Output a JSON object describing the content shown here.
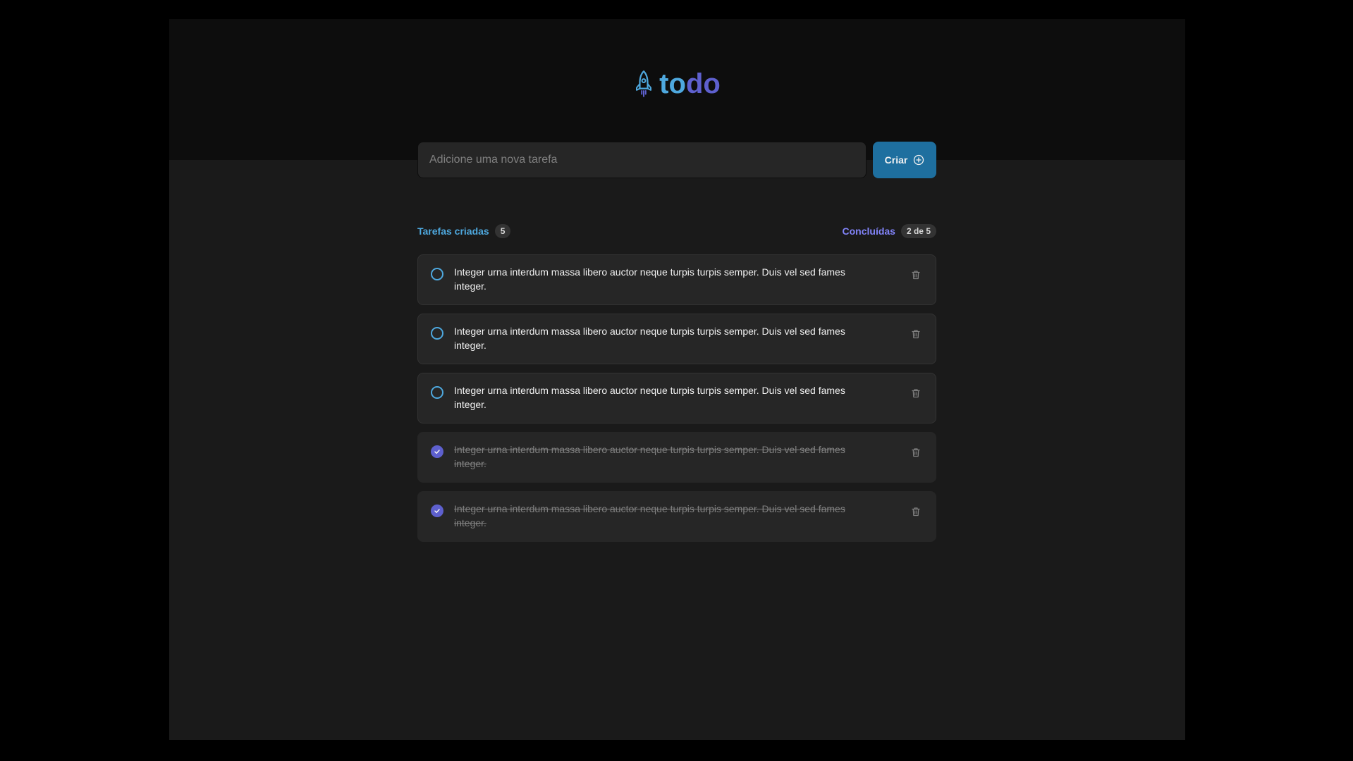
{
  "app": {
    "logo_icon": "rocket-icon",
    "brand_part1": "to",
    "brand_part2": "do",
    "colors": {
      "blue": "#4ea8de",
      "purple": "#5e60ce",
      "button": "#1e6f9f"
    }
  },
  "form": {
    "placeholder": "Adicione uma nova tarefa",
    "value": "",
    "create_label": "Criar",
    "create_icon": "plus-circle-icon"
  },
  "summary": {
    "created_label": "Tarefas criadas",
    "created_count": "5",
    "done_label": "Concluídas",
    "done_count": "2 de 5"
  },
  "tasks": [
    {
      "text": "Integer urna interdum massa libero auctor neque turpis turpis semper. Duis vel sed fames integer.",
      "completed": false
    },
    {
      "text": "Integer urna interdum massa libero auctor neque turpis turpis semper. Duis vel sed fames integer.",
      "completed": false
    },
    {
      "text": "Integer urna interdum massa libero auctor neque turpis turpis semper. Duis vel sed fames integer.",
      "completed": false
    },
    {
      "text": "Integer urna interdum massa libero auctor neque turpis turpis semper. Duis vel sed fames integer.",
      "completed": true
    },
    {
      "text": "Integer urna interdum massa libero auctor neque turpis turpis semper. Duis vel sed fames integer.",
      "completed": true
    }
  ]
}
